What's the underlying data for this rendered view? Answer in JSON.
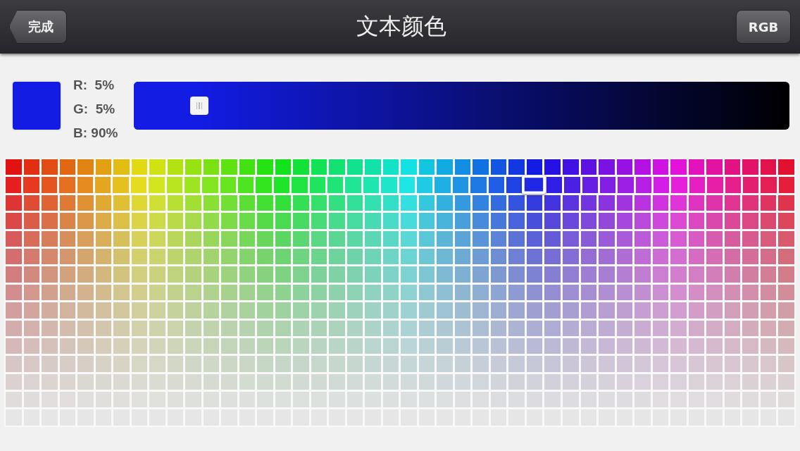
{
  "nav_bar": {
    "back_button": "完成",
    "title": "文本颜色",
    "mode_button": "RGB"
  },
  "readout": {
    "r": "R:  5%",
    "g": "G:  5%",
    "b": "B: 90%"
  },
  "brightness_slider": {
    "level": 0.1
  },
  "swatch_grid": {
    "rows": [
      {
        "selected": false
      },
      {
        "selected": true
      },
      {
        "selected": false
      },
      {
        "selected": false
      },
      {
        "selected": false
      },
      {
        "selected": false
      },
      {
        "selected": false
      },
      {
        "selected": false
      },
      {
        "selected": false
      },
      {
        "selected": false
      },
      {
        "selected": false
      },
      {
        "selected": false
      },
      {
        "selected": false
      },
      {
        "selected": false
      },
      {
        "selected": false
      }
    ],
    "columns": [
      {
        "selected": false
      },
      {
        "selected": false
      },
      {
        "selected": false
      },
      {
        "selected": false
      },
      {
        "selected": false
      },
      {
        "selected": false
      },
      {
        "selected": false
      },
      {
        "selected": false
      },
      {
        "selected": false
      },
      {
        "selected": false
      },
      {
        "selected": false
      },
      {
        "selected": false
      },
      {
        "selected": false
      },
      {
        "selected": false
      },
      {
        "selected": false
      },
      {
        "selected": false
      },
      {
        "selected": false
      },
      {
        "selected": false
      },
      {
        "selected": false
      },
      {
        "selected": false
      },
      {
        "selected": false
      },
      {
        "selected": false
      },
      {
        "selected": false
      },
      {
        "selected": false
      },
      {
        "selected": false
      },
      {
        "selected": false
      },
      {
        "selected": false
      },
      {
        "selected": false
      },
      {
        "selected": false
      },
      {
        "selected": true
      },
      {
        "selected": false
      },
      {
        "selected": false
      },
      {
        "selected": false
      },
      {
        "selected": false
      },
      {
        "selected": false
      },
      {
        "selected": false
      },
      {
        "selected": false
      },
      {
        "selected": false
      },
      {
        "selected": false
      },
      {
        "selected": false
      },
      {
        "selected": false
      },
      {
        "selected": false
      },
      {
        "selected": false
      },
      {
        "selected": false
      }
    ]
  }
}
